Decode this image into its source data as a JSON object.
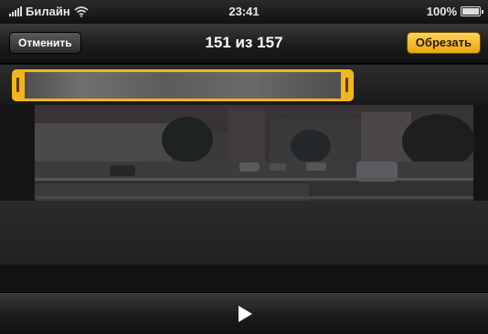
{
  "status_bar": {
    "carrier": "Билайн",
    "time": "23:41",
    "battery": "100%"
  },
  "nav": {
    "cancel_label": "Отменить",
    "title": "151 из 157",
    "trim_label": "Обрезать"
  },
  "colors": {
    "accent": "#f2b51e",
    "bar_dark": "#1c1c1c"
  },
  "icons": {
    "signal": "signal-icon",
    "wifi": "wifi-icon",
    "battery": "battery-icon",
    "play": "play-icon"
  }
}
